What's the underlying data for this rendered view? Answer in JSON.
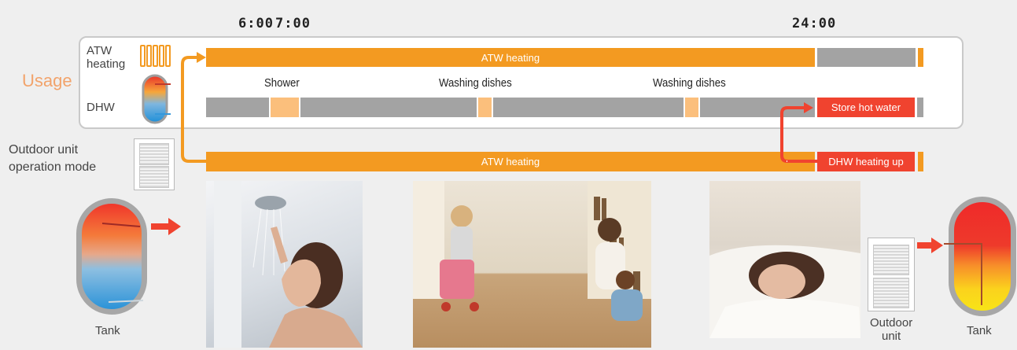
{
  "timeline": {
    "times": [
      "6:00",
      "7:00",
      "24:00"
    ]
  },
  "usage_panel": {
    "usage_label": "Usage",
    "atw_label": "ATW\nheating",
    "dhw_label": "DHW",
    "atw_bar_label": "ATW heating",
    "events": [
      "Shower",
      "Washing dishes",
      "Washing dishes"
    ],
    "store_label": "Store hot water"
  },
  "operation_mode": {
    "label": "Outdoor unit\noperation mode",
    "atw_bar_label": "ATW heating",
    "dhw_bar_label": "DHW heating up"
  },
  "bottom": {
    "left_tank_label": "Tank",
    "outdoor_label": "Outdoor\nunit",
    "right_tank_label": "Tank"
  },
  "colors": {
    "orange": "#f39a21",
    "gray": "#a3a3a3",
    "peach": "#fbbf7c",
    "red": "#f0432f",
    "usage": "#f2a36b"
  }
}
